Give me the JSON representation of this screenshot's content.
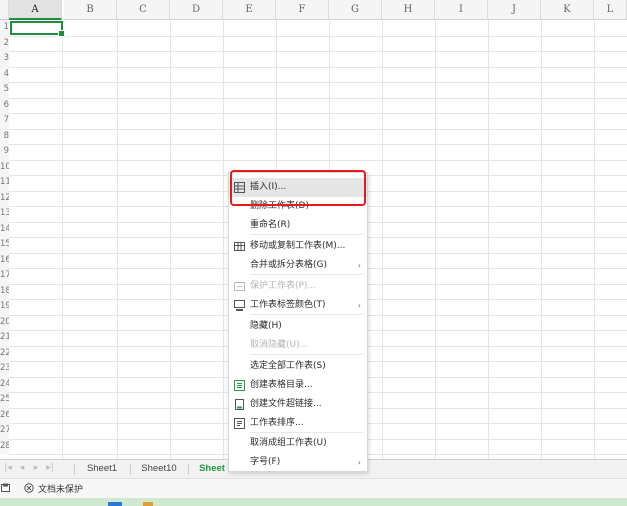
{
  "spreadsheet": {
    "columns": [
      "A",
      "B",
      "C",
      "D",
      "E",
      "F",
      "G",
      "H",
      "I",
      "J",
      "K",
      "L"
    ],
    "active_cell": "A1",
    "row_numbers": [
      "1",
      "2",
      "3",
      "4",
      "5",
      "6",
      "7",
      "8",
      "9",
      "10",
      "11",
      "12",
      "13",
      "14",
      "15",
      "16",
      "17",
      "18",
      "19",
      "20",
      "21",
      "22",
      "23",
      "24",
      "25",
      "26",
      "27",
      "28"
    ]
  },
  "sheet_tabs": [
    "Sheet1",
    "Sheet10",
    "Sheet"
  ],
  "active_sheet_index": 2,
  "status_bar": {
    "protection_label": "文档未保护"
  },
  "context_menu": {
    "items": [
      {
        "label": "插入(I)...",
        "icon": "insert-sheet-icon",
        "disabled": false,
        "hover": true
      },
      {
        "label": "删除工作表(D)",
        "icon": null,
        "disabled": false
      },
      {
        "label": "重命名(R)",
        "icon": null,
        "disabled": false
      },
      {
        "label": "移动或复制工作表(M)...",
        "icon": "move-copy-sheet-icon",
        "disabled": false
      },
      {
        "label": "合并或拆分表格(G)",
        "icon": null,
        "disabled": false,
        "submenu": true
      },
      {
        "label": "保护工作表(P)...",
        "icon": "protect-sheet-icon",
        "disabled": true
      },
      {
        "label": "工作表标签颜色(T)",
        "icon": "tab-color-icon",
        "disabled": false,
        "submenu": true
      },
      {
        "label": "隐藏(H)",
        "icon": null,
        "disabled": false
      },
      {
        "label": "取消隐藏(U)...",
        "icon": null,
        "disabled": true
      },
      {
        "label": "选定全部工作表(S)",
        "icon": null,
        "disabled": false
      },
      {
        "label": "创建表格目录...",
        "icon": "table-directory-icon",
        "disabled": false
      },
      {
        "label": "创建文件超链接...",
        "icon": "file-hyperlink-icon",
        "disabled": false
      },
      {
        "label": "工作表排序...",
        "icon": "sheet-sort-icon",
        "disabled": false
      },
      {
        "label": "取消成组工作表(U)",
        "icon": null,
        "disabled": false
      },
      {
        "label": "字号(F)",
        "icon": null,
        "disabled": false,
        "submenu": true
      }
    ],
    "submenu_arrow": "›"
  },
  "colors": {
    "accent_green": "#1e8e3e",
    "highlight_red": "#e51a1a",
    "hover_gray": "#e6e6e6"
  }
}
